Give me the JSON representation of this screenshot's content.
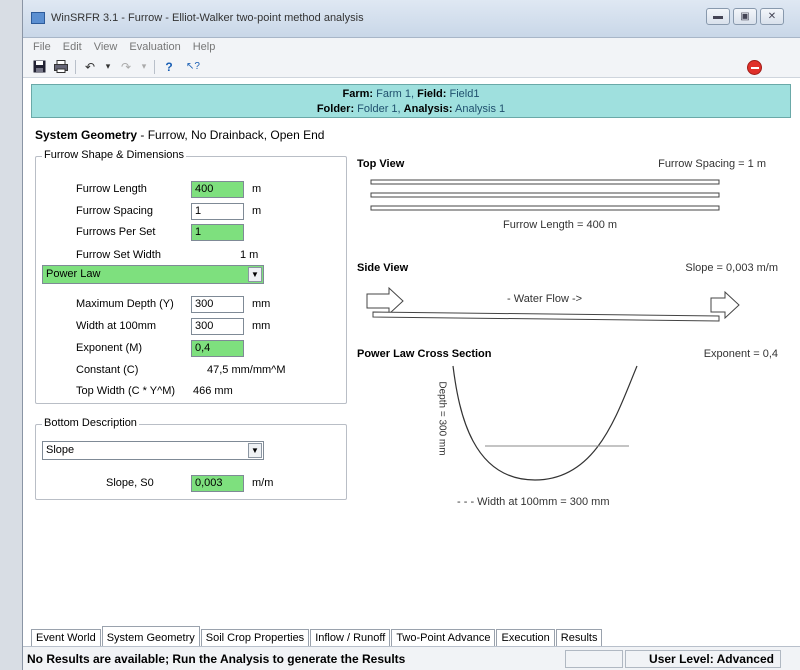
{
  "window": {
    "title": "WinSRFR 3.1 - Furrow - Elliot-Walker two-point method analysis",
    "buttons": {
      "minimize": "▬",
      "maximize": "▣",
      "close": "✕"
    }
  },
  "menu": [
    "File",
    "Edit",
    "View",
    "Evaluation",
    "Help"
  ],
  "toolbar": {
    "icons": [
      "save-icon",
      "print-icon",
      "undo-icon",
      "redo-icon",
      "help-icon",
      "context-help-icon"
    ],
    "undo_glyph": "↶",
    "redo_glyph": "↷",
    "dropdown_glyph": "▾",
    "help_glyph": "?",
    "context_help_glyph": "↖?"
  },
  "header": {
    "farm_label": "Farm:",
    "farm_value": "Farm 1,",
    "field_label": "Field:",
    "field_value": "Field1",
    "folder_label": "Folder:",
    "folder_value": "Folder 1,",
    "analysis_label": "Analysis:",
    "analysis_value": "Analysis 1"
  },
  "system_geometry": {
    "title": "System Geometry",
    "subtitle": "- Furrow, No Drainback, Open End"
  },
  "shape_group": {
    "legend": "Furrow Shape & Dimensions",
    "furrow_length": {
      "label": "Furrow Length",
      "value": "400",
      "unit": "m"
    },
    "furrow_spacing": {
      "label": "Furrow Spacing",
      "value": "1",
      "unit": "m"
    },
    "furrows_per_set": {
      "label": "Furrows Per Set",
      "value": "1"
    },
    "furrow_set_width": {
      "label": "Furrow Set Width",
      "value": "1 m"
    },
    "shape_select": "Power Law",
    "max_depth": {
      "label": "Maximum Depth (Y)",
      "value": "300",
      "unit": "mm"
    },
    "width_100": {
      "label": "Width at 100mm",
      "value": "300",
      "unit": "mm"
    },
    "exponent": {
      "label": "Exponent (M)",
      "value": "0,4"
    },
    "constant": {
      "label": "Constant (C)",
      "value": "47,5 mm/mm^M"
    },
    "top_width": {
      "label": "Top Width (C * Y^M)",
      "value": "466 mm"
    }
  },
  "bottom_group": {
    "legend": "Bottom Description",
    "select": "Slope",
    "slope": {
      "label": "Slope, S0",
      "value": "0,003",
      "unit": "m/m"
    }
  },
  "top_view": {
    "title": "Top View",
    "spacing_note": "Furrow Spacing = 1 m",
    "length_note": "Furrow Length = 400 m"
  },
  "side_view": {
    "title": "Side View",
    "slope_note": "Slope = 0,003 m/m",
    "flow_note": "- Water Flow ->"
  },
  "cross_section": {
    "title": "Power Law Cross Section",
    "exponent_note": "Exponent = 0,4",
    "depth_note": "Depth = 300 mm",
    "width_note": "- - - Width at 100mm = 300 mm"
  },
  "tabs": [
    "Event World",
    "System Geometry",
    "Soil Crop Properties",
    "Inflow / Runoff",
    "Two-Point Advance",
    "Execution",
    "Results"
  ],
  "status": {
    "message": "No Results are available; Run the Analysis to generate the Results",
    "user_level": "User Level:  Advanced"
  },
  "colors": {
    "header_band": "#9fe0de",
    "input_green": "#7ee07e",
    "stop_red": "#e0302a"
  }
}
